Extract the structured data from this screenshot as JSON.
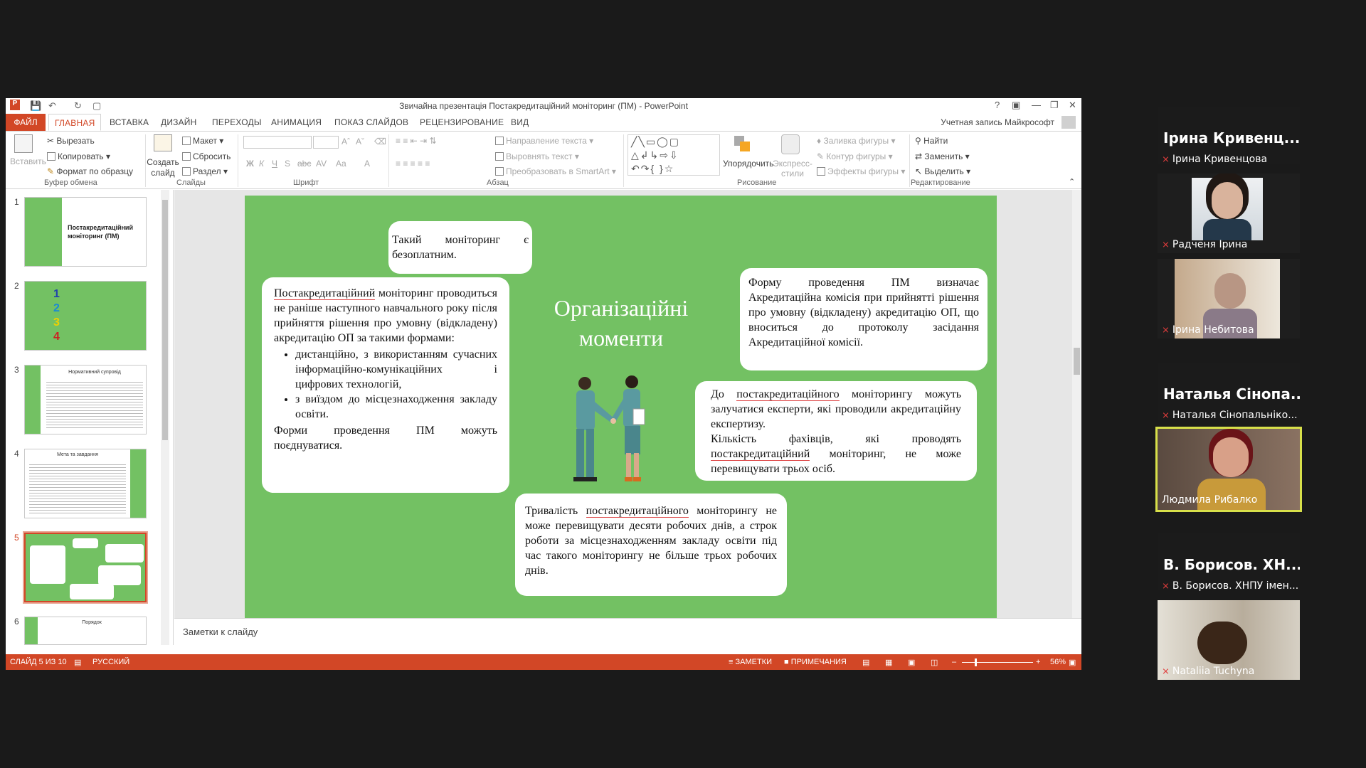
{
  "window": {
    "title": "Звичайна презентація Постакредитаційний моніторинг (ПМ) - PowerPoint",
    "account": "Учетная запись Майкрософт"
  },
  "tabs": [
    "ФАЙЛ",
    "ГЛАВНАЯ",
    "ВСТАВКА",
    "ДИЗАЙН",
    "ПЕРЕХОДЫ",
    "АНИМАЦИЯ",
    "ПОКАЗ СЛАЙДОВ",
    "РЕЦЕНЗИРОВАНИЕ",
    "ВИД"
  ],
  "ribbon": {
    "clipboard": {
      "paste": "Вставить",
      "cut": "Вырезать",
      "copy": "Копировать",
      "format_painter": "Формат по образцу",
      "group": "Буфер обмена"
    },
    "slides": {
      "new_slide": "Создать слайд",
      "layout": "Макет",
      "reset": "Сбросить",
      "section": "Раздел",
      "group": "Слайды"
    },
    "font": {
      "group": "Шрифт"
    },
    "paragraph": {
      "text_direction": "Направление текста",
      "align_text": "Выровнять текст",
      "smartart": "Преобразовать в SmartArt",
      "group": "Абзац"
    },
    "drawing": {
      "arrange": "Упорядочить",
      "quick_styles": "Экспресс-стили",
      "shape_fill": "Заливка фигуры",
      "shape_outline": "Контур фигуры",
      "shape_effects": "Эффекты фигуры",
      "group": "Рисование"
    },
    "editing": {
      "find": "Найти",
      "replace": "Заменить",
      "select": "Выделить",
      "group": "Редактирование"
    }
  },
  "thumbnails": {
    "numbers": [
      "1",
      "2",
      "3",
      "4",
      "5",
      "6"
    ],
    "t1_title": "Постакредитаційний моніторинг (ПМ)",
    "t3_title": "Нормативний супровід",
    "t4_title": "Мета та завдання",
    "t6_title": "Порядок"
  },
  "slide": {
    "title": "Організаційні моменти",
    "card_free": "Такий моніторинг є безоплатним.",
    "card_left_underlined": "Постакредитаційний",
    "card_left_intro": " моніторинг проводиться не раніше наступного навчального року після прийняття рішення про умовну (відкладену) акредитацію ОП за такими формами:",
    "card_left_bullets": [
      "дистанційно, з використанням сучасних інформаційно-комунікаційних і цифрових технологій,",
      "з виїздом до місцезнаходження закладу освіти."
    ],
    "card_left_outro": "Форми проведення ПМ можуть поєднуватися.",
    "card_right_top": "Форму проведення ПМ визначає Акредитаційна комісія при прийнятті рішення про умовну (відкладену) акредитацію ОП, що вноситься до протоколу засідання Акредитаційної комісії.",
    "card_experts_1a": "До ",
    "card_experts_1u": "постакредитаційного",
    "card_experts_1b": " моніторингу можуть залучатися експерти, які проводили акредитаційну експертизу.",
    "card_experts_2a": "Кількість фахівців, які проводять ",
    "card_experts_2u": "постакредитаційний",
    "card_experts_2b": " моніторинг, не може перевищувати трьох осіб.",
    "card_duration_a": "Тривалість ",
    "card_duration_u": "постакредитаційного",
    "card_duration_b": " моніторингу не може перевищувати десяти робочих днів, а строк роботи за місцезнаходженням закладу освіти під час такого моніторингу не більше трьох робочих днів."
  },
  "notes_placeholder": "Заметки к слайду",
  "status": {
    "slide_of": "СЛАЙД 5 ИЗ 10",
    "language": "РУССКИЙ",
    "notes": "ЗАМЕТКИ",
    "comments": "ПРИМЕЧАНИЯ",
    "zoom": "56%"
  },
  "participants": [
    {
      "display": "Ірина Кривенц...",
      "label": "Ірина Кривенцова",
      "video": false
    },
    {
      "label": "Радченя Ірина",
      "video": true
    },
    {
      "label": "Ірина Небитова",
      "video": true
    },
    {
      "display": "Наталья Сінопа...",
      "label": "Наталья Сінопальніко...",
      "video": false
    },
    {
      "label": "Людмила Рибалко",
      "video": true,
      "speaking": true
    },
    {
      "display": "В. Борисов. ХН...",
      "label": "В. Борисов. ХНПУ імен...",
      "video": false
    },
    {
      "label": "Nataliia Tuchyna",
      "video": true
    }
  ],
  "colors": {
    "accent": "#d24726",
    "slide_bg": "#73c163",
    "speaking_border": "#d8e04a"
  }
}
